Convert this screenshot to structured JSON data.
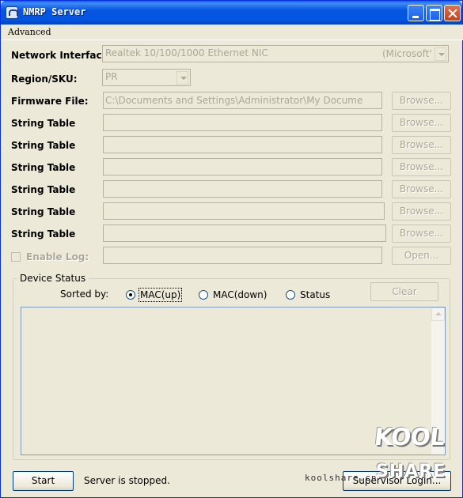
{
  "window": {
    "title": "NMRP Server"
  },
  "menu": {
    "advanced": "Advanced"
  },
  "network": {
    "label": "Network Interface:",
    "value": "Realtek 10/100/1000 Ethernet NIC",
    "vendor": "(Microsoft'"
  },
  "region": {
    "label": "Region/SKU:",
    "value": "PR"
  },
  "firmware": {
    "label": "Firmware File:",
    "value": "C:\\Documents and Settings\\Administrator\\My Docume",
    "browse": "Browse..."
  },
  "string_tables": [
    {
      "label": "String Table",
      "value": "",
      "browse": "Browse..."
    },
    {
      "label": "String Table",
      "value": "",
      "browse": "Browse..."
    },
    {
      "label": "String Table",
      "value": "",
      "browse": "Browse..."
    },
    {
      "label": "String Table",
      "value": "",
      "browse": "Browse..."
    },
    {
      "label": "String Table",
      "value": "",
      "browse": "Browse..."
    },
    {
      "label": "String Table",
      "value": "",
      "browse": "Browse..."
    }
  ],
  "log": {
    "label": "Enable Log:",
    "value": "",
    "open": "Open...",
    "checked": false
  },
  "device_status": {
    "legend": "Device Status",
    "sorted_by": "Sorted by:",
    "options": [
      "MAC(up)",
      "MAC(down)",
      "Status"
    ],
    "selected": "MAC(up)",
    "clear": "Clear"
  },
  "footer": {
    "start": "Start",
    "status": "Server is stopped.",
    "supervisor": "Supervisor Login..."
  },
  "watermark": {
    "top": "KOOL",
    "bottom": "SHARE",
    "url": "koolshare.cn"
  }
}
